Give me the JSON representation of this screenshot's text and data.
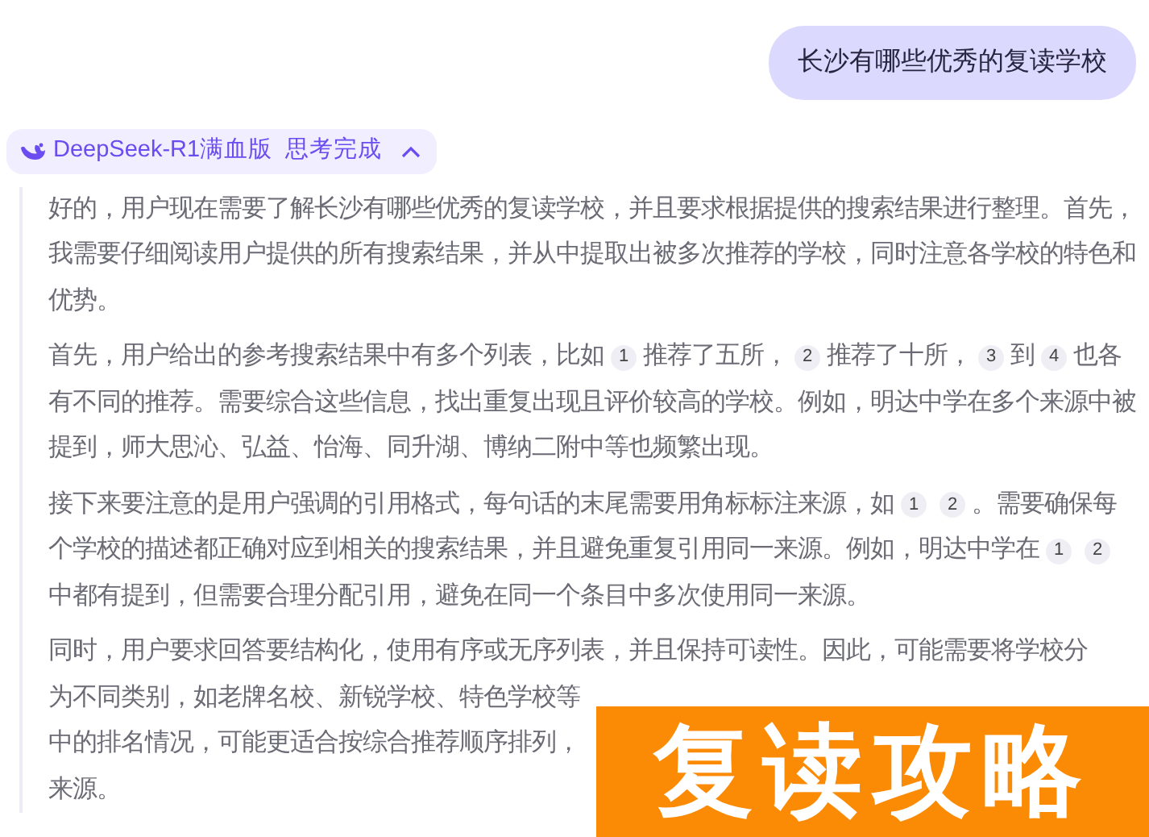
{
  "user_message": "长沙有哪些优秀的复读学校",
  "thinking_header": {
    "model": "DeepSeek-R1满血版",
    "status": "思考完成",
    "expanded": true
  },
  "thinking_paragraphs": [
    {
      "segments": [
        {
          "kind": "text",
          "text": "好的，用户现在需要了解长沙有哪些优秀的复读学校，并且要求根据提供的搜索结果进行整理。首先，我需要仔细阅读用户提供的所有搜索结果，并从中提取出被多次推荐的学校，同时注意各学校的特色和优势。"
        }
      ]
    },
    {
      "segments": [
        {
          "kind": "text",
          "text": "首先，用户给出的参考搜索结果中有多个列表，比如"
        },
        {
          "kind": "cite",
          "text": "1"
        },
        {
          "kind": "text",
          "text": "推荐了五所，"
        },
        {
          "kind": "cite",
          "text": "2"
        },
        {
          "kind": "text",
          "text": "推荐了十所，"
        },
        {
          "kind": "cite",
          "text": "3"
        },
        {
          "kind": "text",
          "text": "到"
        },
        {
          "kind": "cite",
          "text": "4"
        },
        {
          "kind": "text",
          "text": "也各有不同的推荐。需要综合这些信息，找出重复出现且评价较高的学校。例如，明达中学在多个来源中被提到，师大思沁、弘益、怡海、同升湖、博纳二附中等也频繁出现。"
        }
      ]
    },
    {
      "segments": [
        {
          "kind": "text",
          "text": "接下来要注意的是用户强调的引用格式，每句话的末尾需要用角标标注来源，如"
        },
        {
          "kind": "cite",
          "text": "1"
        },
        {
          "kind": "cite",
          "text": "2"
        },
        {
          "kind": "text",
          "text": "。需要确保每个学校的描述都正确对应到相关的搜索结果，并且避免重复引用同一来源。例如，明达中学在"
        },
        {
          "kind": "cite",
          "text": "1"
        },
        {
          "kind": "cite",
          "text": "2"
        },
        {
          "kind": "text",
          "text": "中都有提到，但需要合理分配引用，避免在同一个条目中多次使用同一来源。"
        }
      ]
    },
    {
      "lines": [
        "同时，用户要求回答要结构化，使用有序或无序列表，并且保持可读性。因此，可能需要将学校分",
        "为不同类别，如老牌名校、新锐学校、特色学校等",
        "中的排名情况，可能更适合按综合推荐顺序排列，",
        "来源。"
      ]
    }
  ],
  "overlay_caption": "复读攻略"
}
